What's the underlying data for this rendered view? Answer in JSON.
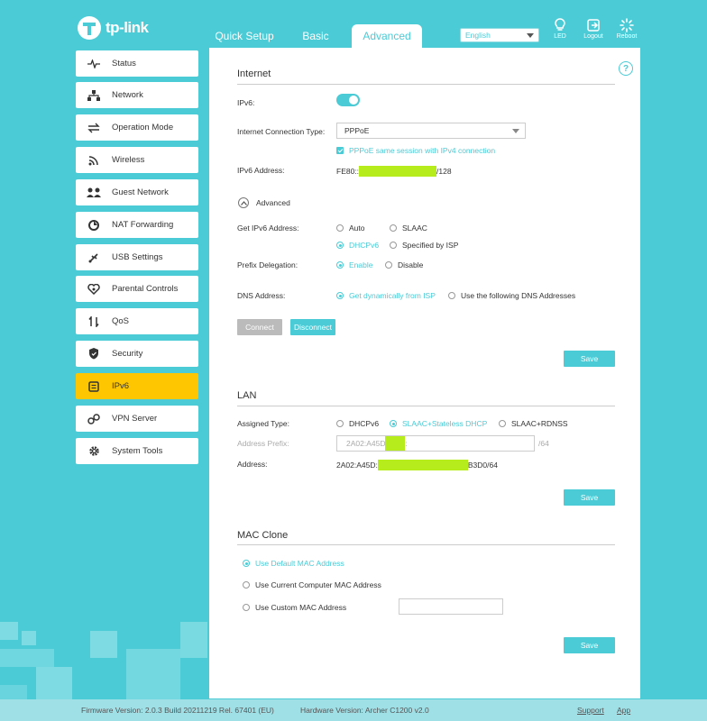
{
  "brand": {
    "name": "tp-link"
  },
  "tabs": [
    {
      "label": "Quick Setup"
    },
    {
      "label": "Basic"
    },
    {
      "label": "Advanced"
    }
  ],
  "language": {
    "selected": "English"
  },
  "header_buttons": [
    {
      "label": "LED",
      "icon": "bulb-icon"
    },
    {
      "label": "Logout",
      "icon": "logout-icon"
    },
    {
      "label": "Reboot",
      "icon": "reboot-icon"
    }
  ],
  "sidebar": {
    "items": [
      {
        "label": "Status",
        "icon": "pulse-icon"
      },
      {
        "label": "Network",
        "icon": "network-icon"
      },
      {
        "label": "Operation Mode",
        "icon": "operation-mode-icon"
      },
      {
        "label": "Wireless",
        "icon": "wireless-icon"
      },
      {
        "label": "Guest Network",
        "icon": "guest-network-icon"
      },
      {
        "label": "NAT Forwarding",
        "icon": "nat-forwarding-icon"
      },
      {
        "label": "USB Settings",
        "icon": "usb-icon"
      },
      {
        "label": "Parental Controls",
        "icon": "parental-controls-icon"
      },
      {
        "label": "QoS",
        "icon": "qos-icon"
      },
      {
        "label": "Security",
        "icon": "shield-icon"
      },
      {
        "label": "IPv6",
        "icon": "ipv6-icon",
        "active": true
      },
      {
        "label": "VPN Server",
        "icon": "vpn-icon"
      },
      {
        "label": "System Tools",
        "icon": "gear-icon"
      }
    ]
  },
  "internet": {
    "title": "Internet",
    "ipv6_label": "IPv6:",
    "ipv6_enabled": true,
    "conn_type_label": "Internet Connection Type:",
    "conn_type_value": "PPPoE",
    "pppoe_same_session": "PPPoE same session with IPv4 connection",
    "ipv6_address_label": "IPv6 Address:",
    "ipv6_address_prefix": "FE80::",
    "ipv6_address_suffix": "/128",
    "advanced_label": "Advanced",
    "get_ipv6_label": "Get IPv6 Address:",
    "get_ipv6_options": [
      "Auto",
      "SLAAC",
      "DHCPv6",
      "Specified by ISP"
    ],
    "get_ipv6_selected": "DHCPv6",
    "prefix_delegation_label": "Prefix Delegation:",
    "prefix_delegation_options": [
      "Enable",
      "Disable"
    ],
    "prefix_delegation_selected": "Enable",
    "dns_label": "DNS Address:",
    "dns_options": [
      "Get dynamically from ISP",
      "Use the following DNS Addresses"
    ],
    "dns_selected": "Get dynamically from ISP",
    "connect_label": "Connect",
    "disconnect_label": "Disconnect",
    "save_label": "Save"
  },
  "lan": {
    "title": "LAN",
    "assigned_type_label": "Assigned Type:",
    "assigned_type_options": [
      "DHCPv6",
      "SLAAC+Stateless DHCP",
      "SLAAC+RDNSS"
    ],
    "assigned_type_selected": "SLAAC+Stateless DHCP",
    "address_prefix_label": "Address Prefix:",
    "address_prefix_start": "2A02:A45D",
    "address_prefix_end": ":",
    "address_prefix_suffix": "/64",
    "address_label": "Address:",
    "address_start": "2A02:A45D:",
    "address_end": "B3D0/64",
    "save_label": "Save"
  },
  "mac_clone": {
    "title": "MAC Clone",
    "options": [
      "Use Default MAC Address",
      "Use Current Computer MAC Address",
      "Use Custom MAC Address"
    ],
    "selected": "Use Default MAC Address",
    "custom_value": "",
    "save_label": "Save"
  },
  "footer": {
    "firmware": "Firmware Version: 2.0.3 Build 20211219 Rel. 67401 (EU)",
    "hardware": "Hardware Version: Archer C1200 v2.0",
    "support": "Support",
    "app": "App"
  },
  "colors": {
    "background": "#4acbd6",
    "accent": "#4acbd6",
    "active_item": "#fdc600",
    "redaction": "#b6eb1c"
  }
}
